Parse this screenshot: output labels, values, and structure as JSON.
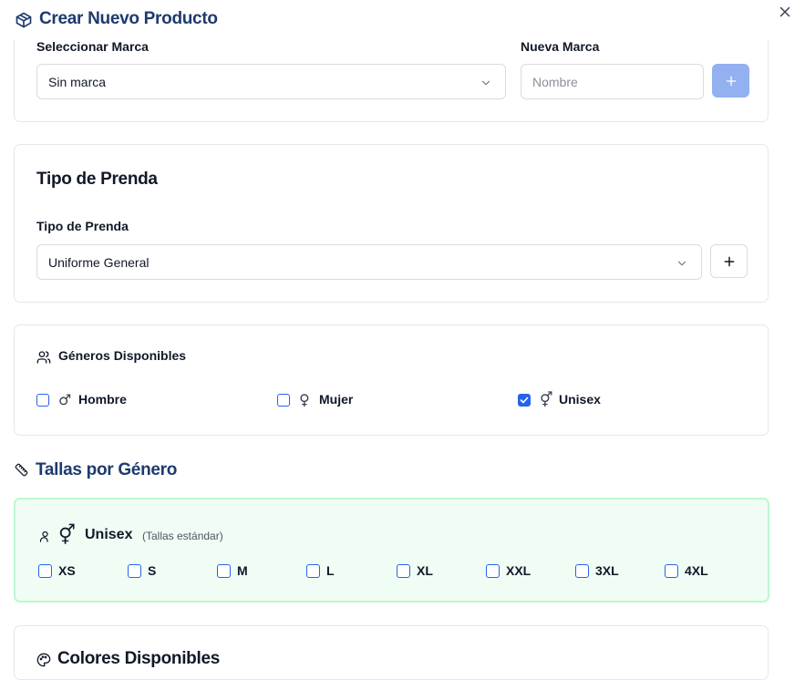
{
  "header": {
    "title": "Crear Nuevo Producto",
    "icon": "package-icon",
    "close_icon": "close-icon"
  },
  "marca": {
    "select_label": "Seleccionar Marca",
    "select_value": "Sin marca",
    "new_label": "Nueva Marca",
    "new_placeholder": "Nombre",
    "add_icon": "plus-icon"
  },
  "tipo_prenda": {
    "section_title": "Tipo de Prenda",
    "field_label": "Tipo de Prenda",
    "select_value": "Uniforme General",
    "add_icon": "plus-icon"
  },
  "generos": {
    "section_title": "Géneros Disponibles",
    "icon": "users-icon",
    "options": [
      {
        "label": "Hombre",
        "symbol": "♂",
        "checked": false
      },
      {
        "label": "Mujer",
        "symbol": "♀",
        "checked": false
      },
      {
        "label": "Unisex",
        "symbol": "⚥",
        "checked": true
      }
    ]
  },
  "tallas": {
    "section_title": "Tallas por Género",
    "icon": "ruler-icon",
    "group": {
      "gender": "Unisex",
      "symbol": "⚥",
      "note": "(Tallas estándar)",
      "sizes": [
        {
          "label": "XS",
          "checked": false
        },
        {
          "label": "S",
          "checked": false
        },
        {
          "label": "M",
          "checked": false
        },
        {
          "label": "L",
          "checked": false
        },
        {
          "label": "XL",
          "checked": false
        },
        {
          "label": "XXL",
          "checked": false
        },
        {
          "label": "3XL",
          "checked": false
        },
        {
          "label": "4XL",
          "checked": false
        }
      ]
    }
  },
  "colores": {
    "section_title": "Colores Disponibles",
    "icon": "palette-icon"
  },
  "colors": {
    "accent": "#2563eb",
    "title_blue": "#1e3a6e",
    "disabled_button": "#93b1f0",
    "tallas_bg": "#f0fdf4",
    "tallas_border": "#bbf7d0"
  }
}
